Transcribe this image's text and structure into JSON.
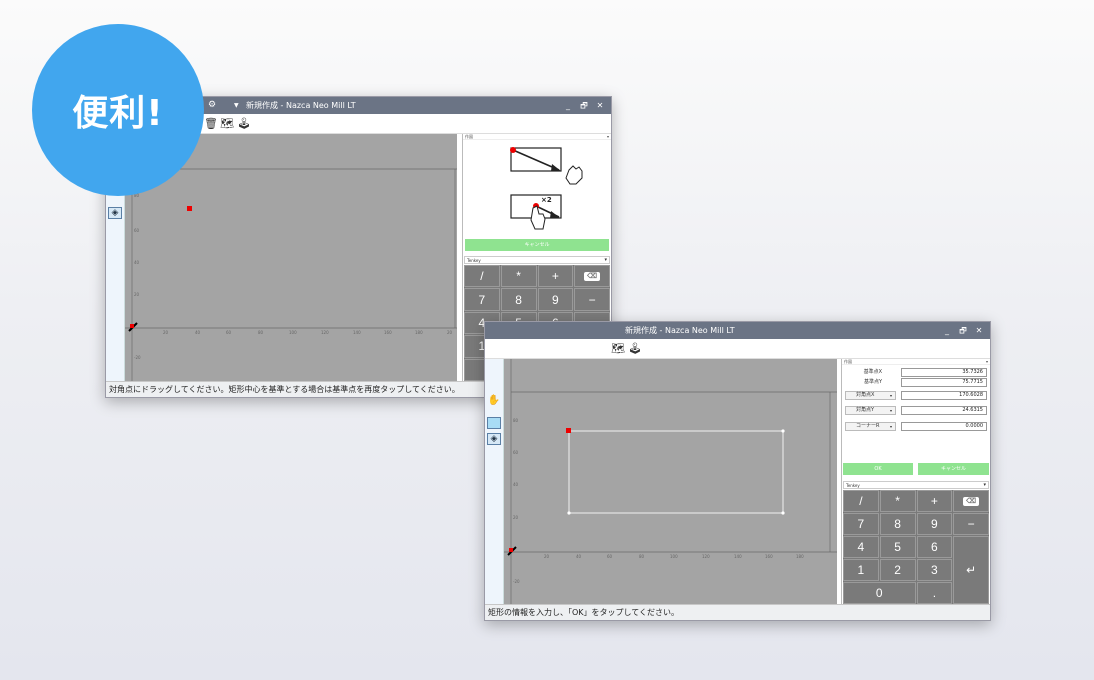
{
  "badge": {
    "text": "便利!"
  },
  "window1": {
    "title": "新規作成 - Nazca Neo Mill LT",
    "controls": [
      "_",
      "🗗",
      "✕"
    ],
    "panel_title": "作図",
    "cancel_label": "キャンセル",
    "combo_value": "Tenkey",
    "status": "対角点にドラッグしてください。矩形中心を基準とする場合は基準点を再度タップしてください。",
    "guide_text": "×2"
  },
  "window2": {
    "title": "新規作成 - Nazca Neo Mill LT",
    "controls": [
      "_",
      "🗗",
      "✕"
    ],
    "panel_title": "作図",
    "ok_label": "OK",
    "cancel_label": "キャンセル",
    "combo_value": "Tenkey",
    "status": "矩形の情報を入力し、「OK」をタップしてください。",
    "fields": [
      {
        "label": "基準点X",
        "value": "35.7326"
      },
      {
        "label": "基準点Y",
        "value": "75.7715"
      },
      {
        "label": "対角点X",
        "value": "170.6028"
      },
      {
        "label": "対角点Y",
        "value": "24.6315"
      },
      {
        "label": "コーナーR",
        "value": "0.0000"
      }
    ]
  },
  "keypad": {
    "keys": [
      "/",
      "*",
      "+",
      "⌫",
      "7",
      "8",
      "9",
      "−",
      "4",
      "5",
      "6",
      "↵",
      "1",
      "2",
      "3",
      "0",
      "."
    ]
  },
  "axis_ticks": {
    "x": [
      "20",
      "40",
      "60",
      "80",
      "100",
      "120",
      "140",
      "160",
      "180",
      "20"
    ],
    "y": [
      "80",
      "60",
      "40",
      "20",
      "-20"
    ]
  },
  "colors": {
    "badge": "#41a6ee",
    "titlebar": "#6b7485",
    "canvas": "#a4a4a4",
    "green_button": "#8fe390",
    "keypad": "#7a7a7a",
    "point": "#ee0000"
  }
}
